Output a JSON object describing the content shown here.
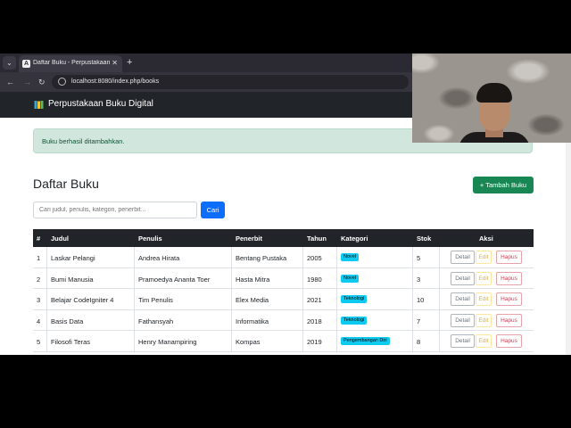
{
  "browser": {
    "tab_title": "Daftar Buku - Perpustakaan Digital",
    "tab_favicon": "A",
    "url": "localhost:8080/index.php/books"
  },
  "navbar": {
    "brand": "Perpustakaan Buku Digital"
  },
  "alert": {
    "text": "Buku berhasil ditambahkan."
  },
  "page": {
    "title": "Daftar Buku",
    "add_button": "+ Tambah Buku"
  },
  "search": {
    "placeholder": "Cari judul, penulis, kategori, penerbit...",
    "button": "Cari"
  },
  "table": {
    "headers": {
      "no": "#",
      "judul": "Judul",
      "penulis": "Penulis",
      "penerbit": "Penerbit",
      "tahun": "Tahun",
      "kategori": "Kategori",
      "stok": "Stok",
      "aksi": "Aksi"
    },
    "actions": {
      "detail": "Detail",
      "edit": "Edit",
      "hapus": "Hapus"
    },
    "rows": [
      {
        "no": "1",
        "judul": "Laskar Pelangi",
        "penulis": "Andrea Hirata",
        "penerbit": "Bentang Pustaka",
        "tahun": "2005",
        "kategori": "Novel",
        "stok": "5"
      },
      {
        "no": "2",
        "judul": "Bumi Manusia",
        "penulis": "Pramoedya Ananta Toer",
        "penerbit": "Hasta Mitra",
        "tahun": "1980",
        "kategori": "Novel",
        "stok": "3"
      },
      {
        "no": "3",
        "judul": "Belajar CodeIgniter 4",
        "penulis": "Tim Penulis",
        "penerbit": "Elex Media",
        "tahun": "2021",
        "kategori": "Teknologi",
        "stok": "10"
      },
      {
        "no": "4",
        "judul": "Basis Data",
        "penulis": "Fathansyah",
        "penerbit": "Informatika",
        "tahun": "2018",
        "kategori": "Teknologi",
        "stok": "7"
      },
      {
        "no": "5",
        "judul": "Filosofi Teras",
        "penulis": "Henry Manampiring",
        "penerbit": "Kompas",
        "tahun": "2019",
        "kategori": "Pengembangan Diri",
        "stok": "8"
      }
    ]
  },
  "colors": {
    "navbar": "#212529",
    "success": "#198754",
    "primary": "#0d6efd",
    "badge": "#0dcaf0"
  }
}
